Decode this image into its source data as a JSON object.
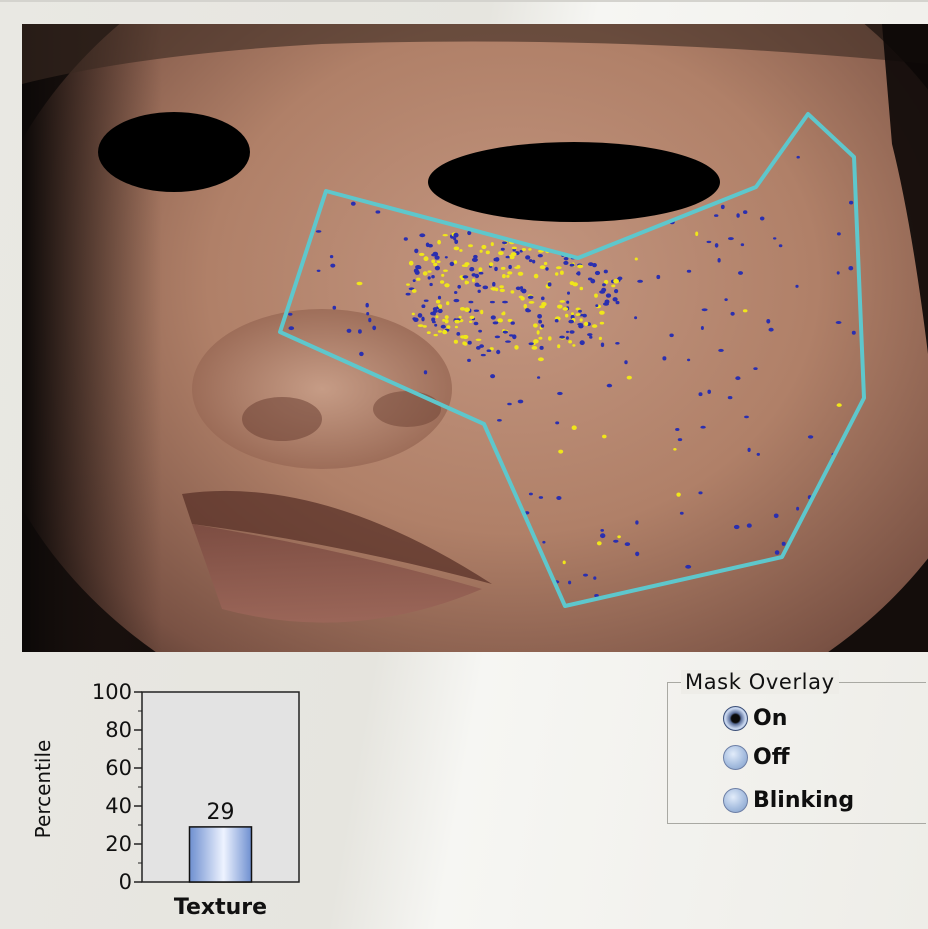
{
  "mask_overlay": {
    "legend": "Mask Overlay",
    "options": [
      {
        "label": "On",
        "selected": true
      },
      {
        "label": "Off",
        "selected": false
      },
      {
        "label": "Blinking",
        "selected": false
      }
    ]
  },
  "chart_data": {
    "type": "bar",
    "categories": [
      "Texture"
    ],
    "values": [
      29
    ],
    "ylabel": "Percentile",
    "xlabel": "",
    "ylim": [
      0,
      100
    ],
    "yticks": [
      "0",
      "20",
      "40",
      "60",
      "80",
      "100"
    ],
    "data_labels": [
      "29"
    ],
    "grid": false
  },
  "colors": {
    "mask_outline": "#5ec7cc",
    "spot_blue": "#2a2fb0",
    "spot_yellow": "#f0e61a",
    "bar_fill_light": "#eef3ff",
    "bar_fill_dark": "#6e8fd0"
  }
}
